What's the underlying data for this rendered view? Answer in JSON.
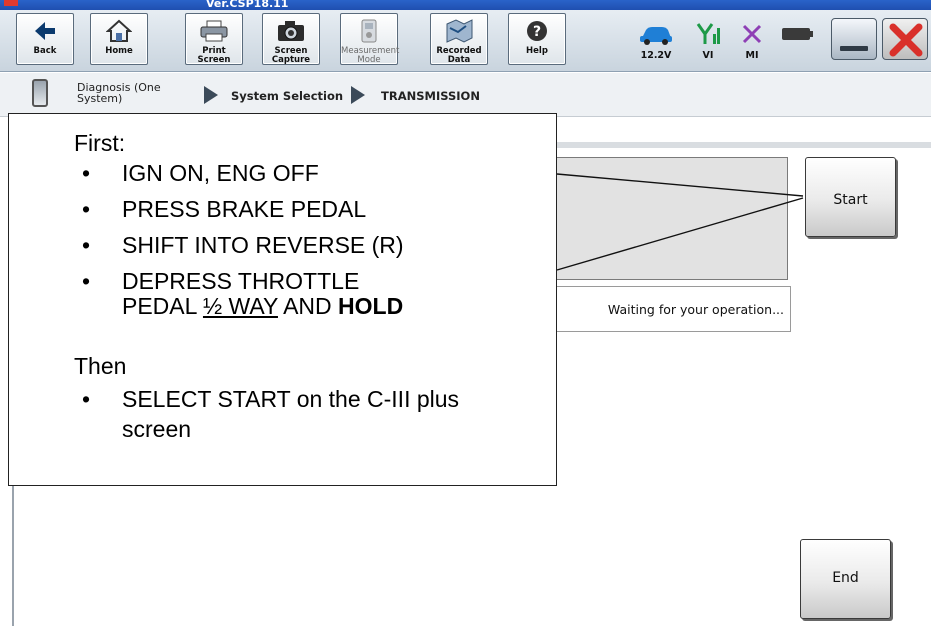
{
  "app": {
    "version": "Ver.CSP18.11"
  },
  "toolbar": {
    "buttons": [
      {
        "label": "Back",
        "icon": "back-arrow-icon"
      },
      {
        "label": "Home",
        "icon": "home-icon"
      },
      {
        "label": "Print Screen",
        "icon": "printer-icon"
      },
      {
        "label": "Screen\nCapture",
        "icon": "camera-icon"
      },
      {
        "label": "Measurement\nMode",
        "icon": "measurement-icon"
      },
      {
        "label": "Recorded\nData",
        "icon": "recorded-data-icon"
      },
      {
        "label": "Help",
        "icon": "help-icon"
      }
    ],
    "status": {
      "voltage": "12.2V",
      "vi_label": "VI",
      "mi_label": "MI"
    }
  },
  "breadcrumb": {
    "items": [
      "Diagnosis (One System)",
      "System Selection",
      "TRANSMISSION"
    ]
  },
  "main": {
    "status_message": "Waiting for your operation...",
    "start_label": "Start",
    "end_label": "End"
  },
  "callout": {
    "first_label": "First:",
    "steps": [
      "IGN ON, ENG OFF",
      "PRESS BRAKE PEDAL",
      "SHIFT INTO REVERSE (R)"
    ],
    "throttle_step": {
      "line1": "DEPRESS THROTTLE",
      "pre": "PEDAL ",
      "underlined": "½ WAY",
      "mid": " AND ",
      "bold": "HOLD"
    },
    "then_label": "Then",
    "final_step": "SELECT START on the C-III plus screen"
  },
  "colors": {
    "title_bar": "#2a63c9",
    "close_red": "#d9302a",
    "status_blue": "#1f7fd6",
    "vi_green": "#1e9a48",
    "mi_purple": "#8e3fb5"
  }
}
